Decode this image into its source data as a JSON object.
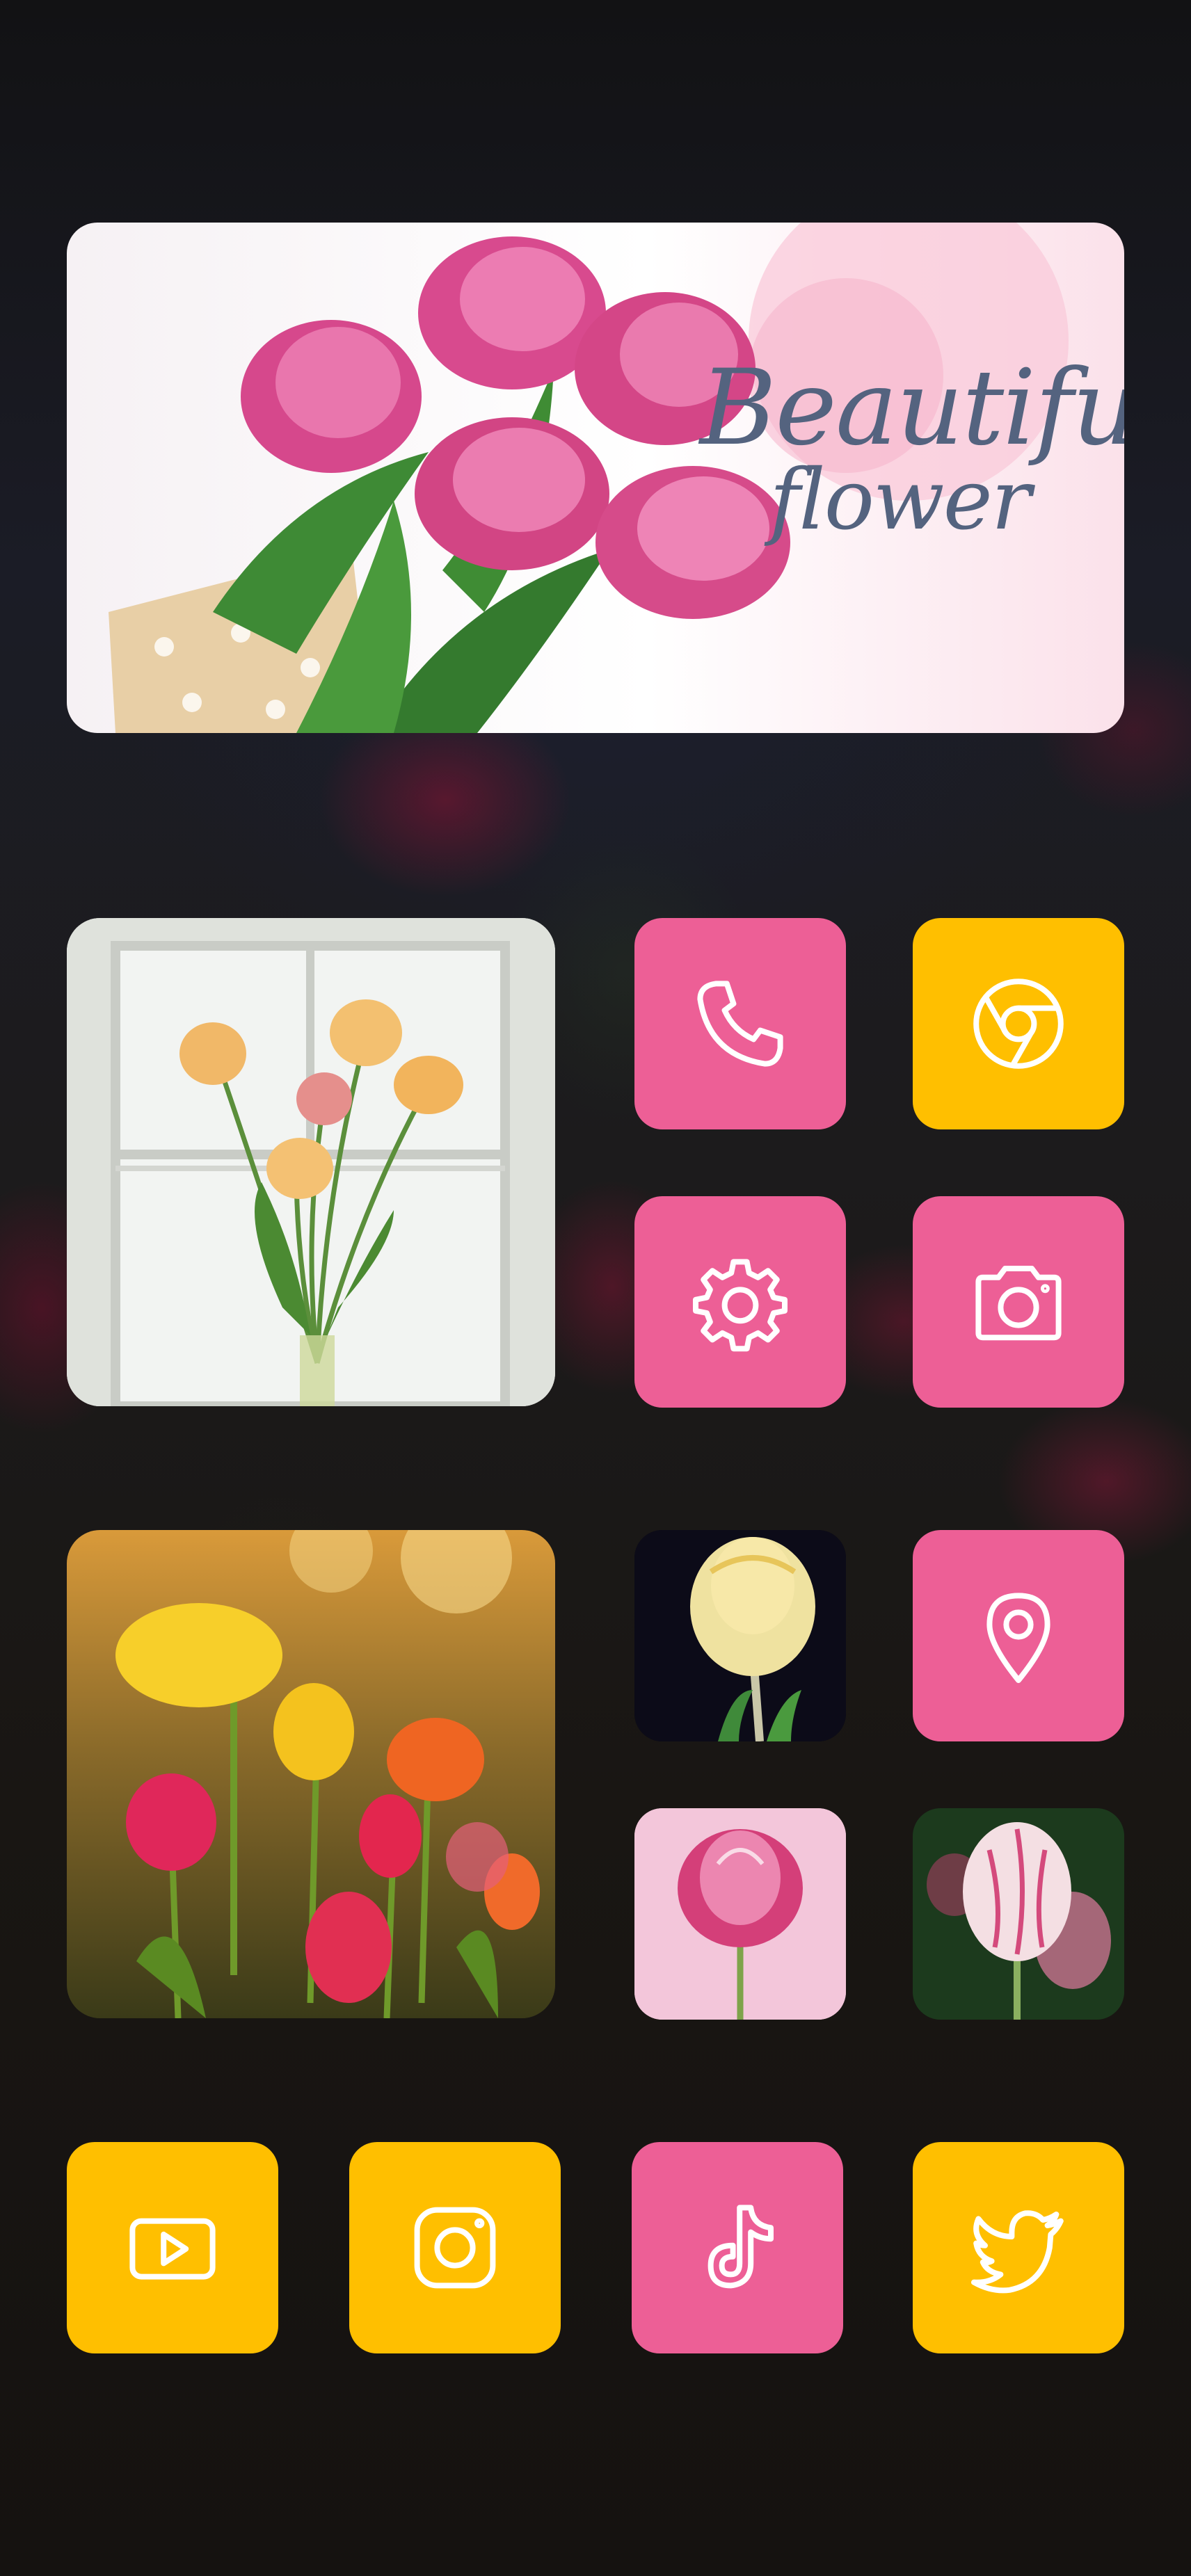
{
  "wallpaper": {
    "subject": "dark tulip field"
  },
  "banner": {
    "line1": "Beautiful",
    "line2": "flower",
    "text_color": "#54637f"
  },
  "colors": {
    "pink_tile": "#ed5f96",
    "yellow_tile": "#ffbf00",
    "icon_stroke": "#ffffff"
  },
  "widgets": [
    {
      "name": "window-tulips-photo",
      "subject": "yellow and pink tulips in a vase by a window"
    },
    {
      "name": "tulip-field-photo",
      "subject": "colorful tulips in sunset light"
    }
  ],
  "apps": [
    {
      "icon": "phone-icon",
      "color": "pink"
    },
    {
      "icon": "chrome-icon",
      "color": "yellow"
    },
    {
      "icon": "settings-gear-icon",
      "color": "pink"
    },
    {
      "icon": "camera-icon",
      "color": "pink"
    },
    {
      "icon": "yellow-tulip-photo-icon",
      "color": "photo"
    },
    {
      "icon": "location-pin-icon",
      "color": "pink"
    },
    {
      "icon": "pink-tulip-photo-icon",
      "color": "photo"
    },
    {
      "icon": "striped-tulip-photo-icon",
      "color": "photo"
    }
  ],
  "dock": [
    {
      "icon": "youtube-icon",
      "color": "yellow"
    },
    {
      "icon": "instagram-icon",
      "color": "yellow"
    },
    {
      "icon": "tiktok-icon",
      "color": "pink"
    },
    {
      "icon": "twitter-icon",
      "color": "yellow"
    }
  ]
}
